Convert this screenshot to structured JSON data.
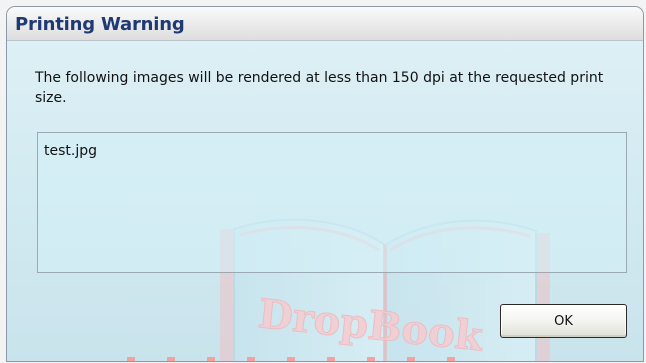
{
  "dialog": {
    "title": "Printing Warning",
    "message": "The following images will be rendered at less than 150 dpi at the requested print size.",
    "files": [
      "test.jpg"
    ],
    "ok_label": "OK"
  },
  "watermark": {
    "text": "DropBook"
  },
  "colors": {
    "title_text": "#1f3a72",
    "dialog_background": "#d4ebf2",
    "watermark_pink": "#f2a3a0"
  }
}
